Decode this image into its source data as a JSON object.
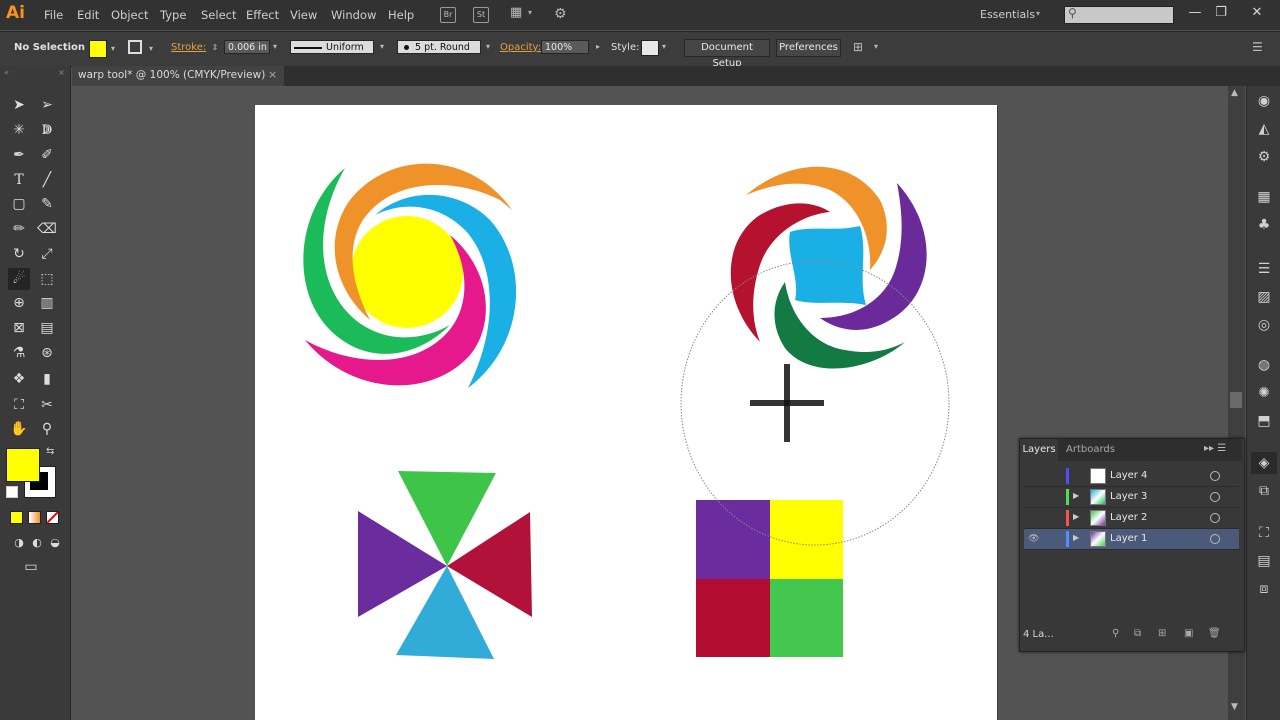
{
  "app": {
    "logo": "Ai",
    "workspace": "Essentials",
    "search_placeholder": ""
  },
  "menu": [
    "File",
    "Edit",
    "Object",
    "Type",
    "Select",
    "Effect",
    "View",
    "Window",
    "Help"
  ],
  "menu_icons": {
    "bridge": "Br",
    "stock": "St"
  },
  "window_controls": {
    "minimize": "—",
    "restore": "❐",
    "close": "✕"
  },
  "control": {
    "selection": "No Selection",
    "fill_color": "#ffff00",
    "stroke_label": "Stroke:",
    "stroke_weight": "0.006 in",
    "stroke_profile": "Uniform",
    "brush": "5 pt. Round",
    "opacity_label": "Opacity:",
    "opacity": "100%",
    "style_label": "Style:",
    "document_setup": "Document Setup",
    "preferences": "Preferences"
  },
  "document": {
    "tab_title": "warp tool* @ 100% (CMYK/Preview)",
    "close": "×"
  },
  "tools": {
    "fill_color": "#ffff00",
    "stroke_color": "#000000",
    "icons": [
      "selection-tool",
      "direct-selection-tool",
      "magic-wand-tool",
      "lasso-tool",
      "pen-tool",
      "curvature-tool",
      "type-tool",
      "line-segment-tool",
      "rectangle-tool",
      "paintbrush-tool",
      "pencil-tool",
      "eraser-tool",
      "rotate-tool",
      "scale-tool",
      "warp-tool",
      "free-transform-tool",
      "shape-builder-tool",
      "perspective-grid-tool",
      "mesh-tool",
      "gradient-tool",
      "eyedropper-tool",
      "blend-tool",
      "symbol-sprayer-tool",
      "column-graph-tool",
      "artboard-tool",
      "slice-tool",
      "hand-tool",
      "zoom-tool"
    ]
  },
  "layers_panel": {
    "tab_layers": "Layers",
    "tab_artboards": "Artboards",
    "layers": [
      {
        "name": "Layer 4",
        "color": "#4f4fff",
        "selected": false,
        "visible_eye": false
      },
      {
        "name": "Layer 3",
        "color": "#4fe04f",
        "selected": false,
        "visible_eye": false
      },
      {
        "name": "Layer 2",
        "color": "#ff4f4f",
        "selected": false,
        "visible_eye": false
      },
      {
        "name": "Layer 1",
        "color": "#4f8fff",
        "selected": true,
        "visible_eye": true
      }
    ],
    "count": "4 La..."
  },
  "artwork_colors": {
    "orange": "#f0922a",
    "cyan": "#1ab0e6",
    "magenta": "#e6198c",
    "green": "#1cbb5a",
    "yellow": "#ffff00",
    "crimson": "#b5122f",
    "purple": "#6a2a9a",
    "darkgreen": "#137a43",
    "triangle_green": "#3fc44a",
    "triangle_red": "#b2123a",
    "triangle_purple": "#6b2c9e",
    "triangle_blue": "#31acd9",
    "square_purple": "#6b2c9e",
    "square_yellow": "#ffff00",
    "square_red": "#b20c33",
    "square_green": "#44c74f"
  }
}
